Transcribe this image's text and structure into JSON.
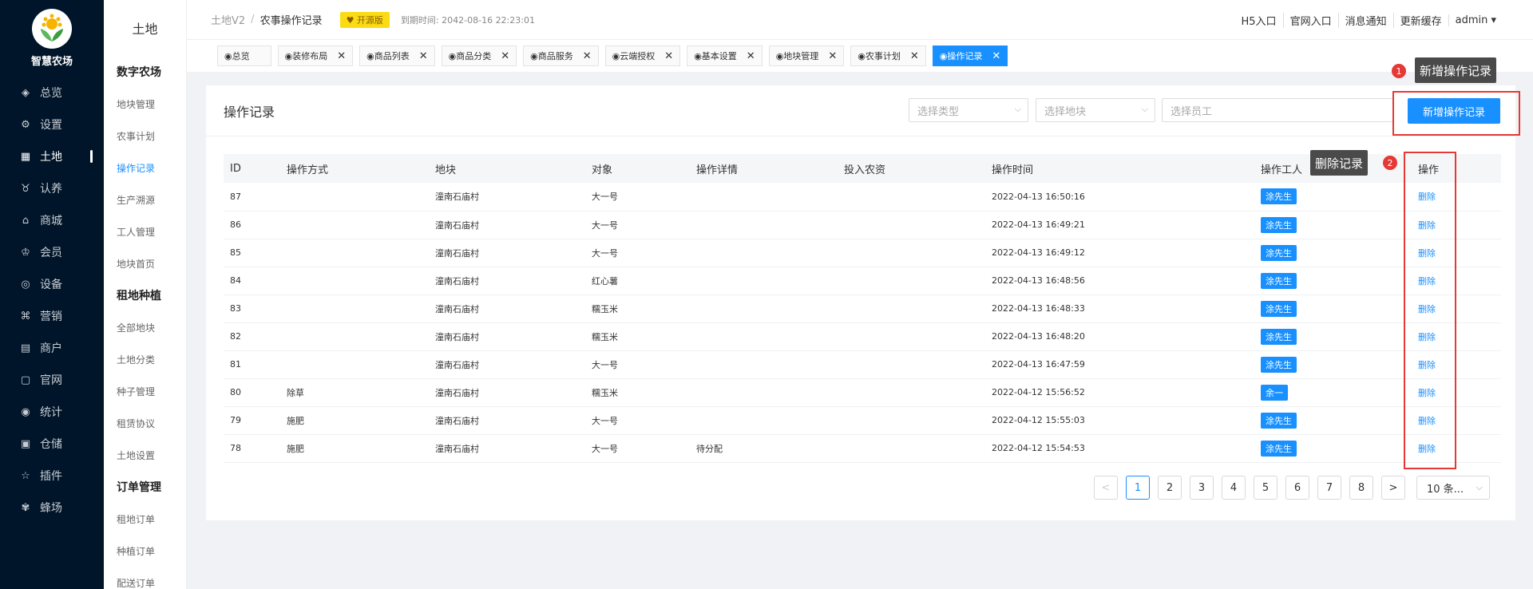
{
  "app": {
    "name": "智慧农场"
  },
  "sidebar": {
    "items": [
      {
        "icon": "dashboard-icon",
        "label": "总览"
      },
      {
        "icon": "gear-icon",
        "label": "设置"
      },
      {
        "icon": "land-icon",
        "label": "土地",
        "active": true
      },
      {
        "icon": "adopt-icon",
        "label": "认养"
      },
      {
        "icon": "shop-icon",
        "label": "商城"
      },
      {
        "icon": "member-icon",
        "label": "会员"
      },
      {
        "icon": "device-icon",
        "label": "设备"
      },
      {
        "icon": "marketing-icon",
        "label": "营销"
      },
      {
        "icon": "merchant-icon",
        "label": "商户"
      },
      {
        "icon": "website-icon",
        "label": "官网"
      },
      {
        "icon": "stats-icon",
        "label": "统计"
      },
      {
        "icon": "warehouse-icon",
        "label": "仓储"
      },
      {
        "icon": "plugin-icon",
        "label": "插件"
      },
      {
        "icon": "bee-icon",
        "label": "蜂场"
      }
    ]
  },
  "subsidebar": {
    "title": "土地",
    "groups": [
      {
        "title": "数字农场",
        "items": [
          "地块管理",
          "农事计划",
          "操作记录",
          "生产溯源",
          "工人管理",
          "地块首页"
        ]
      },
      {
        "title": "租地种植",
        "items": [
          "全部地块",
          "土地分类",
          "种子管理",
          "租赁协议",
          "土地设置"
        ]
      },
      {
        "title": "订单管理",
        "items": [
          "租地订单",
          "种植订单",
          "配送订单"
        ]
      }
    ],
    "active": "操作记录"
  },
  "header": {
    "crumb_root": "土地V2",
    "crumb_sep": "/",
    "crumb_current": "农事操作记录",
    "edition_badge": "开源版",
    "expire_label": "到期时间: 2042-08-16 22:23:01",
    "links": [
      "H5入口",
      "官网入口",
      "消息通知",
      "更新缓存",
      "admin ▾"
    ]
  },
  "tabs": [
    {
      "label": "◉总览",
      "closable": false
    },
    {
      "label": "◉装修布局",
      "closable": true
    },
    {
      "label": "◉商品列表",
      "closable": true
    },
    {
      "label": "◉商品分类",
      "closable": true
    },
    {
      "label": "◉商品服务",
      "closable": true
    },
    {
      "label": "◉云端授权",
      "closable": true
    },
    {
      "label": "◉基本设置",
      "closable": true
    },
    {
      "label": "◉地块管理",
      "closable": true
    },
    {
      "label": "◉农事计划",
      "closable": true
    },
    {
      "label": "◉操作记录",
      "closable": true,
      "active": true
    }
  ],
  "main": {
    "title": "操作记录",
    "filters": {
      "type_placeholder": "选择类型",
      "plot_placeholder": "选择地块",
      "staff_placeholder": "选择员工"
    },
    "add_button": "新增操作记录",
    "columns": [
      "ID",
      "操作方式",
      "地块",
      "对象",
      "操作详情",
      "投入农资",
      "操作时间",
      "操作工人",
      "操作"
    ],
    "rows": [
      {
        "id": "87",
        "method": "",
        "plot": "潼南石庙村",
        "object": "大一号",
        "detail": "",
        "input": "",
        "time": "2022-04-13 16:50:16",
        "worker": "涂先生",
        "action": "删除"
      },
      {
        "id": "86",
        "method": "",
        "plot": "潼南石庙村",
        "object": "大一号",
        "detail": "",
        "input": "",
        "time": "2022-04-13 16:49:21",
        "worker": "涂先生",
        "action": "删除"
      },
      {
        "id": "85",
        "method": "",
        "plot": "潼南石庙村",
        "object": "大一号",
        "detail": "",
        "input": "",
        "time": "2022-04-13 16:49:12",
        "worker": "涂先生",
        "action": "删除"
      },
      {
        "id": "84",
        "method": "",
        "plot": "潼南石庙村",
        "object": "红心薯",
        "detail": "",
        "input": "",
        "time": "2022-04-13 16:48:56",
        "worker": "涂先生",
        "action": "删除"
      },
      {
        "id": "83",
        "method": "",
        "plot": "潼南石庙村",
        "object": "糯玉米",
        "detail": "",
        "input": "",
        "time": "2022-04-13 16:48:33",
        "worker": "涂先生",
        "action": "删除"
      },
      {
        "id": "82",
        "method": "",
        "plot": "潼南石庙村",
        "object": "糯玉米",
        "detail": "",
        "input": "",
        "time": "2022-04-13 16:48:20",
        "worker": "涂先生",
        "action": "删除"
      },
      {
        "id": "81",
        "method": "",
        "plot": "潼南石庙村",
        "object": "大一号",
        "detail": "",
        "input": "",
        "time": "2022-04-13 16:47:59",
        "worker": "涂先生",
        "action": "删除"
      },
      {
        "id": "80",
        "method": "除草",
        "plot": "潼南石庙村",
        "object": "糯玉米",
        "detail": "",
        "input": "",
        "time": "2022-04-12 15:56:52",
        "worker": "余一",
        "action": "删除"
      },
      {
        "id": "79",
        "method": "施肥",
        "plot": "潼南石庙村",
        "object": "大一号",
        "detail": "",
        "input": "",
        "time": "2022-04-12 15:55:03",
        "worker": "涂先生",
        "action": "删除"
      },
      {
        "id": "78",
        "method": "施肥",
        "plot": "潼南石庙村",
        "object": "大一号",
        "detail": "待分配",
        "input": "",
        "time": "2022-04-12 15:54:53",
        "worker": "涂先生",
        "action": "删除"
      }
    ]
  },
  "pagination": {
    "prev": "<",
    "pages": [
      "1",
      "2",
      "3",
      "4",
      "5",
      "6",
      "7",
      "8"
    ],
    "current": "1",
    "next": ">",
    "page_size": "10 条..."
  },
  "annotations": {
    "tip1": {
      "num": "1",
      "text": "新增操作记录"
    },
    "tip2": {
      "num": "2",
      "text": "删除记录"
    }
  },
  "colors": {
    "sidebar_bg": "#001529",
    "primary": "#1890ff",
    "annotation_red": "#e53935"
  }
}
